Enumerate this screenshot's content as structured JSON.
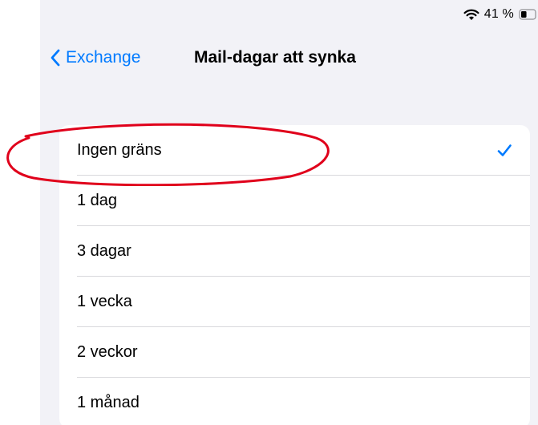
{
  "status_bar": {
    "battery_percent": "41 %",
    "wifi_icon": "wifi-icon",
    "battery_icon": "battery-icon",
    "battery_level": 0.41
  },
  "nav": {
    "back_label": "Exchange",
    "back_icon": "chevron-left-icon",
    "title": "Mail-dagar att synka"
  },
  "list": {
    "items": [
      {
        "label": "Ingen gräns",
        "selected": true
      },
      {
        "label": "1 dag",
        "selected": false
      },
      {
        "label": "3 dagar",
        "selected": false
      },
      {
        "label": "1 vecka",
        "selected": false
      },
      {
        "label": "2 veckor",
        "selected": false
      },
      {
        "label": "1 månad",
        "selected": false
      }
    ],
    "selected_icon": "checkmark-icon"
  },
  "colors": {
    "accent": "#007aff",
    "background": "#f2f2f7",
    "annotation": "#e0001b"
  }
}
